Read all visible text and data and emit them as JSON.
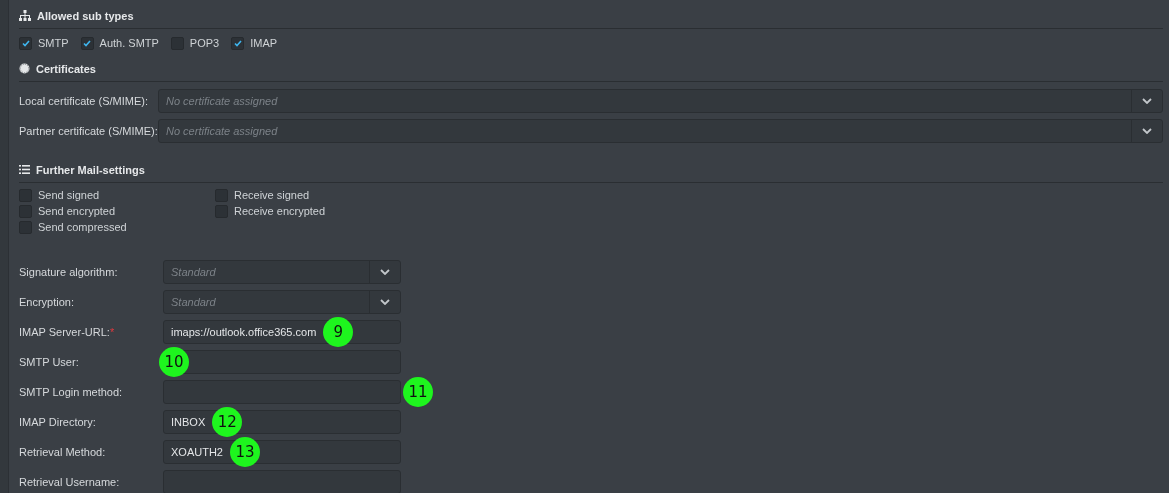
{
  "sections": [
    {
      "kind": "checks",
      "title": "Allowed sub types",
      "options": [
        {
          "label": "SMTP",
          "checked": true
        },
        {
          "label": "Auth. SMTP",
          "checked": true
        },
        {
          "label": "POP3",
          "checked": false
        },
        {
          "label": "IMAP",
          "checked": true
        }
      ]
    },
    {
      "kind": "certs",
      "title": "Certificates",
      "rows": [
        {
          "label": "Local certificate (S/MIME):",
          "placeholder": "No certificate assigned"
        },
        {
          "label": "Partner certificate (S/MIME):",
          "placeholder": "No certificate assigned"
        }
      ]
    },
    {
      "kind": "mail",
      "title": "Further Mail-settings",
      "options": [
        {
          "label": "Send signed",
          "checked": false
        },
        {
          "label": "Receive signed",
          "checked": false
        },
        {
          "label": "Send encrypted",
          "checked": false
        },
        {
          "label": "Receive encrypted",
          "checked": false
        },
        {
          "label": "Send compressed",
          "checked": false
        }
      ],
      "fields": [
        {
          "kind": "select",
          "label": "Signature algorithm:",
          "placeholder": "Standard"
        },
        {
          "kind": "select",
          "label": "Encryption:",
          "placeholder": "Standard"
        },
        {
          "kind": "text",
          "label": "IMAP Server-URL:",
          "required_mark": "*",
          "value": "imaps://outlook.office365.com",
          "marker": "9"
        },
        {
          "kind": "text",
          "label": "SMTP User:",
          "marker": "10"
        },
        {
          "kind": "text",
          "label": "SMTP Login method:",
          "marker": "11"
        },
        {
          "kind": "text",
          "label": "IMAP Directory:",
          "value": "INBOX",
          "marker": "12"
        },
        {
          "kind": "text",
          "label": "Retrieval Method:",
          "value": "XOAUTH2",
          "marker": "13"
        },
        {
          "kind": "text",
          "label": "Retrieval Username:"
        }
      ]
    }
  ]
}
